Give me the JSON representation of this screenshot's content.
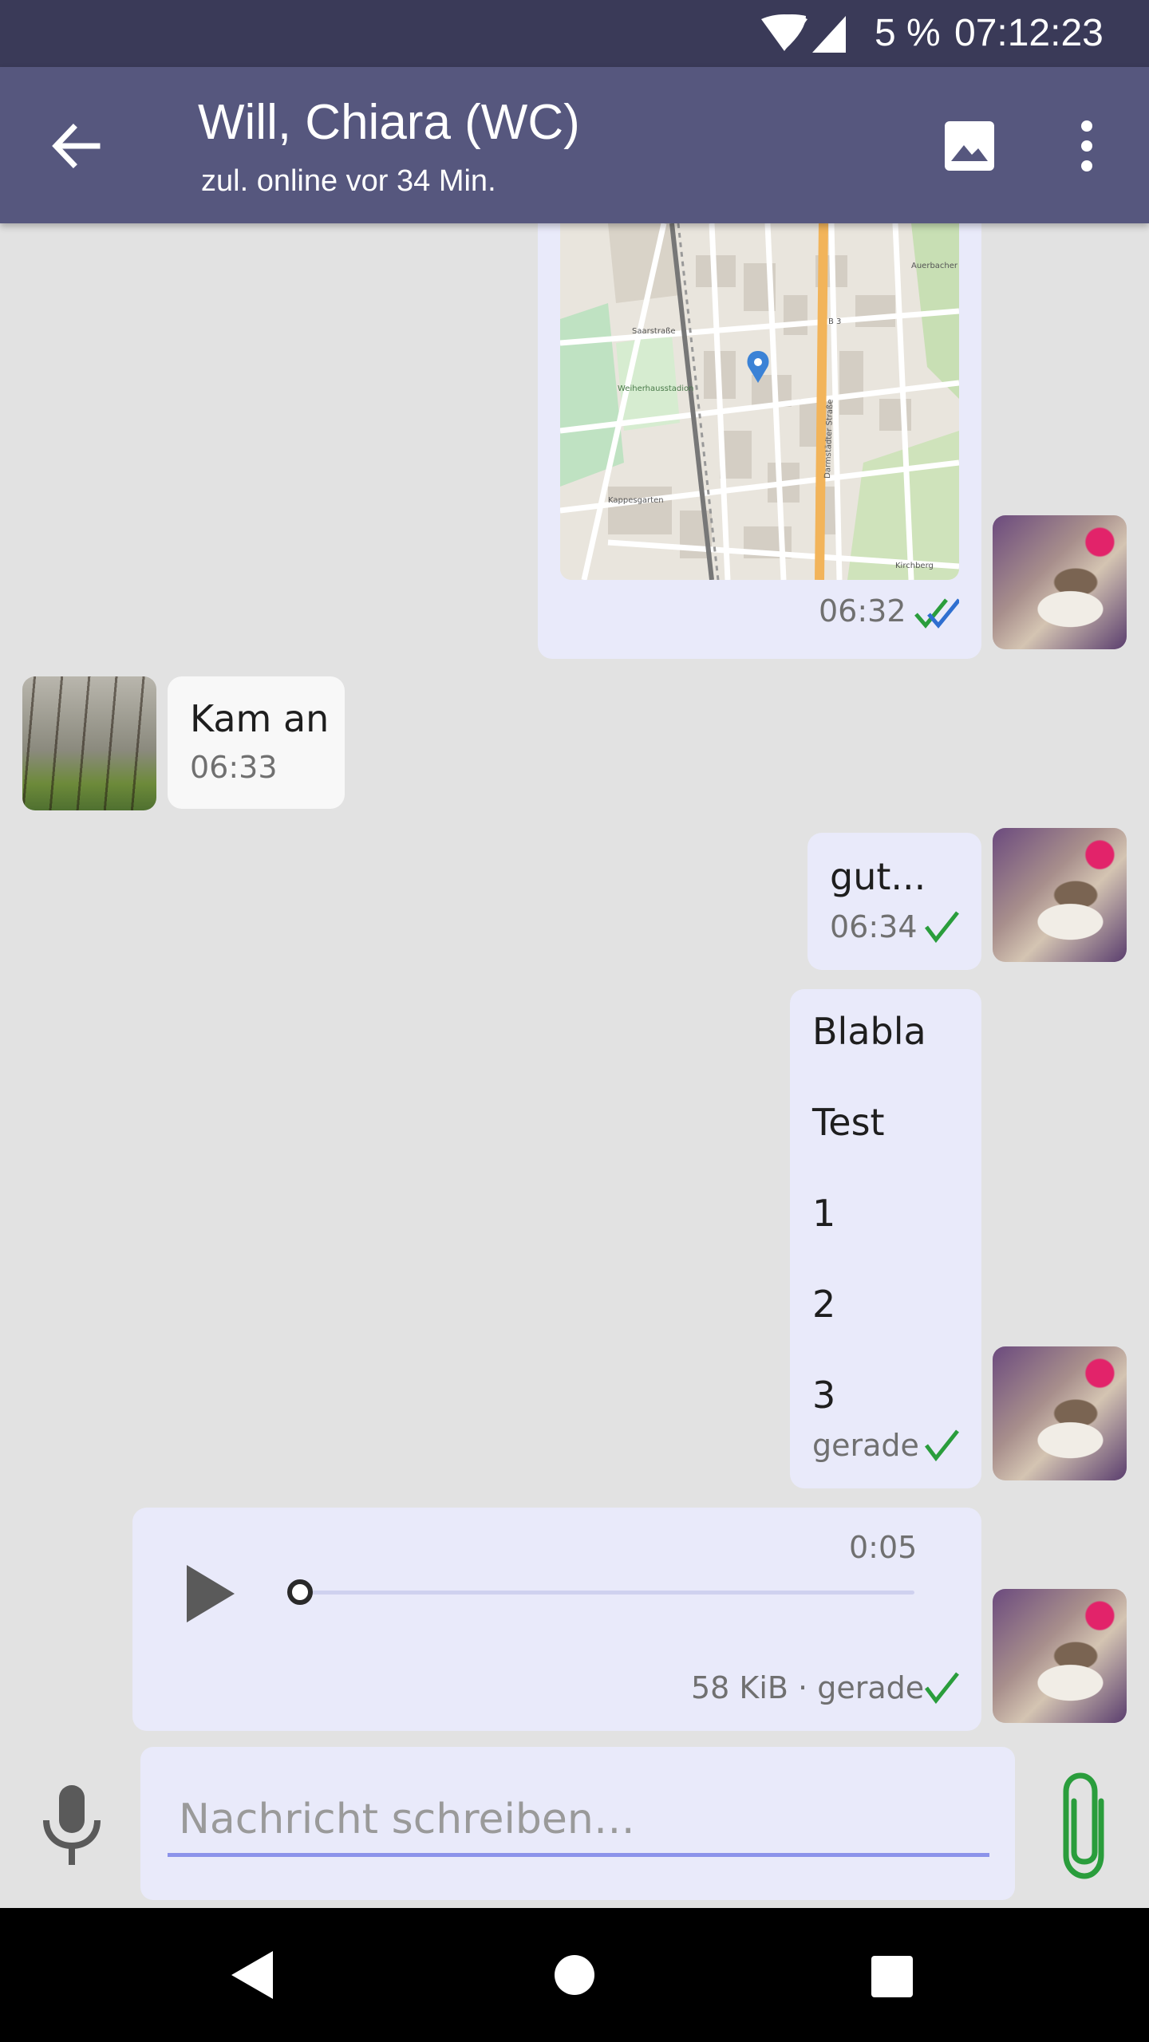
{
  "status_bar": {
    "battery": "5 %",
    "time": "07:12:23"
  },
  "app_bar": {
    "title": "Will, Chiara (WC)",
    "subtitle": "zul. online vor 34 Min.",
    "icons": [
      "back-arrow-icon",
      "gallery-icon",
      "overflow-menu-icon"
    ]
  },
  "messages": [
    {
      "type": "location",
      "direction": "out",
      "time": "06:32",
      "status": "read"
    },
    {
      "type": "text",
      "direction": "in",
      "text": "Kam an",
      "time": "06:33"
    },
    {
      "type": "text",
      "direction": "out",
      "text": "gut...",
      "time": "06:34",
      "status": "sent"
    },
    {
      "type": "text",
      "direction": "out",
      "lines": [
        "Blabla",
        "Test",
        "1",
        "2",
        "3"
      ],
      "time": "gerade",
      "status": "sent"
    },
    {
      "type": "audio",
      "direction": "out",
      "duration": "0:05",
      "progress": 0,
      "meta": "58 KiB · gerade",
      "status": "sent"
    }
  ],
  "map_labels": {
    "saarstrasse": "Saarstraße",
    "darmstaedter": "Darmstädter Straße",
    "weiherhaus": "Weiherhausstadion",
    "kappesgarten": "Kappesgarten",
    "b3": "B 3",
    "kirchberg": "Kirchberg",
    "auerbach": "Auerbacher Fürstenlager"
  },
  "composer": {
    "placeholder": "Nachricht schreiben…",
    "value": ""
  },
  "colors": {
    "app_bar": "#56577e",
    "status_bar": "#3a3a58",
    "outgoing": "#e9eafa",
    "accent_green": "#2a9d3c"
  }
}
